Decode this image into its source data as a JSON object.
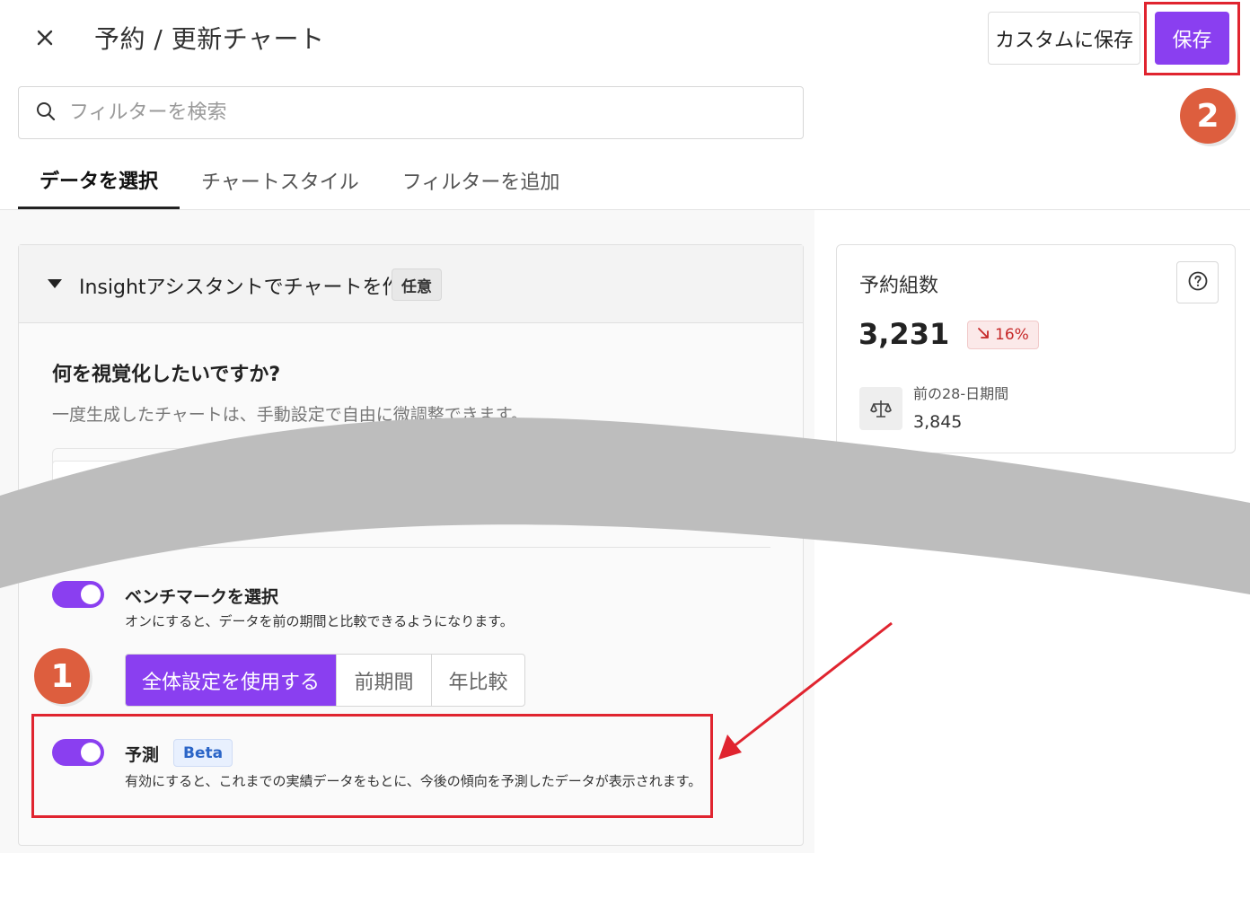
{
  "header": {
    "title": "予約 / 更新チャート",
    "custom_save_label": "カスタムに保存",
    "save_label": "保存"
  },
  "search": {
    "placeholder": "フィルターを検索"
  },
  "tabs": [
    {
      "label": "データを選択",
      "active": true
    },
    {
      "label": "チャートスタイル",
      "active": false
    },
    {
      "label": "フィルターを追加",
      "active": false
    }
  ],
  "assistant": {
    "title": "Insightアシスタントでチャートを作成",
    "badge": "任意",
    "question": "何を視覚化したいですか?",
    "description": "一度生成したチャートは、手動設定で自由に微調整できます。"
  },
  "benchmark": {
    "label": "ベンチマークを選択",
    "description": "オンにすると、データを前の期間と比較できるようになります。",
    "enabled": true,
    "options": [
      "全体設定を使用する",
      "前期間",
      "年比較"
    ],
    "selected": "全体設定を使用する"
  },
  "forecast": {
    "label": "予測",
    "badge": "Beta",
    "description": "有効にすると、これまでの実績データをもとに、今後の傾向を予測したデータが表示されます。",
    "enabled": true
  },
  "metric_card": {
    "title": "予約組数",
    "value": "3,231",
    "delta": "16%",
    "delta_direction": "down",
    "compare_label": "前の28-日期間",
    "compare_value": "3,845"
  },
  "callouts": {
    "first": "1",
    "second": "2"
  },
  "colors": {
    "accent": "#8a3ff0",
    "highlight": "#e0242f",
    "callout": "#dd5e3e",
    "negative": "#c62828",
    "wave": "#bdbdbd"
  }
}
